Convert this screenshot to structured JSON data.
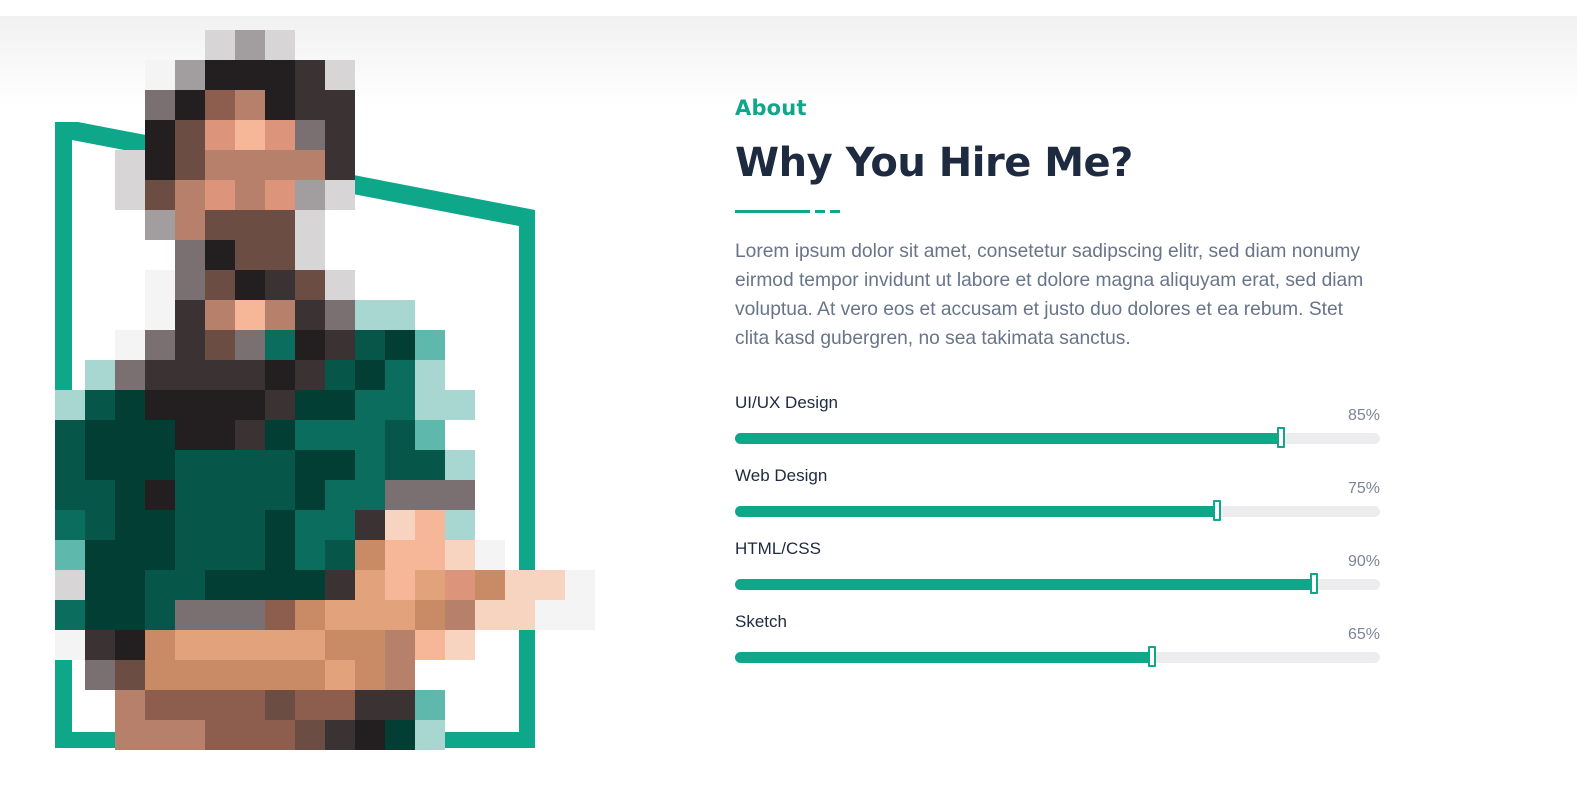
{
  "section": {
    "eyebrow": "About",
    "title": "Why You Hire Me?",
    "description": "Lorem ipsum dolor sit amet, consetetur sadipscing elitr, sed diam nonumy eirmod tempor invidunt ut labore et dolore magna aliquyam erat, sed diam voluptua. At vero eos et accusam et justo duo dolores et ea rebum. Stet clita kasd gubergren, no sea takimata sanctus."
  },
  "skills": [
    {
      "name": "UI/UX Design",
      "percent_label": "85%",
      "value": 0.85
    },
    {
      "name": "Web Design",
      "percent_label": "75%",
      "value": 0.75
    },
    {
      "name": "HTML/CSS",
      "percent_label": "90%",
      "value": 0.9
    },
    {
      "name": "Sketch",
      "percent_label": "65%",
      "value": 0.65
    }
  ],
  "colors": {
    "accent": "#0fa789",
    "heading": "#1d2a3f",
    "body": "#687489",
    "track": "#ededf0"
  },
  "image": {
    "icon": "pixelated-portrait-photo"
  }
}
